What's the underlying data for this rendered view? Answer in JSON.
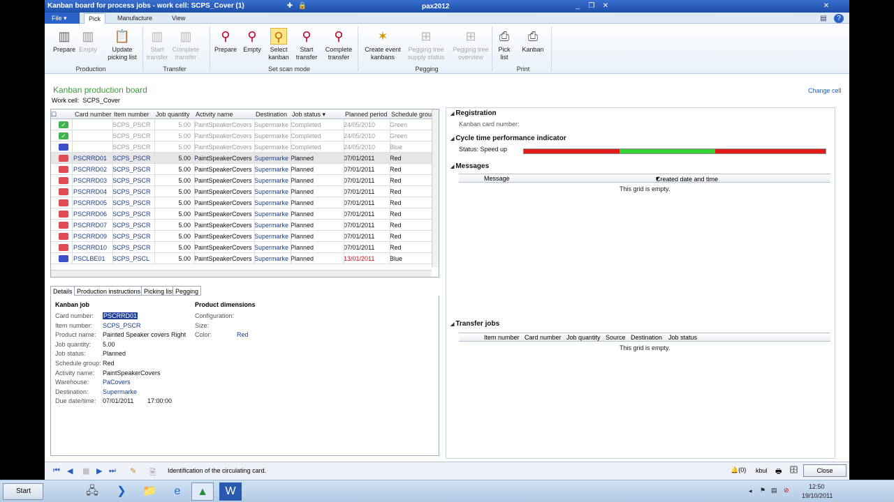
{
  "window": {
    "title": "Kanban board for process jobs - work cell: SCPS_Cover (1)",
    "center": "pax2012"
  },
  "ribbon": {
    "tabs": [
      "File",
      "Pick",
      "Manufacture",
      "View"
    ],
    "buttons": [
      {
        "label": "Prepare",
        "x": 0
      },
      {
        "label": "Empty"
      },
      {
        "label": "Update\npicking list"
      },
      {
        "label": "Start\ntransfer"
      },
      {
        "label": "Complete\ntransfer"
      },
      {
        "label": "Prepare"
      },
      {
        "label": "Empty"
      },
      {
        "label": "Select\nkanban"
      },
      {
        "label": "Start\ntransfer"
      },
      {
        "label": "Complete\ntransfer"
      },
      {
        "label": "Create event\nkanbans"
      },
      {
        "label": "Pegging tree\nsupply status"
      },
      {
        "label": "Pegging tree\noverview"
      },
      {
        "label": "Pick\nlist"
      },
      {
        "label": "Kanban"
      }
    ],
    "groups": [
      "Production",
      "Transfer",
      "Set scan mode",
      "Pegging",
      "Print"
    ]
  },
  "board": {
    "title": "Kanban production board",
    "workcell_label": "Work cell:",
    "workcell": "SCPS_Cover",
    "change_cell": "Change cell"
  },
  "grid": {
    "columns": [
      "Card number",
      "Item number",
      "Job quantity",
      "Activity name",
      "Destination",
      "Job status",
      "Planned period",
      "Schedule grou"
    ],
    "rows": [
      {
        "card": "",
        "item": "SCPS_PSCR",
        "qty": "5.00",
        "activity": "PaintSpeakerCovers",
        "dest": "Supermarke",
        "status": "Completed",
        "period": "24/05/2010",
        "group": "Green"
      },
      {
        "card": "",
        "item": "SCPS_PSCR",
        "qty": "5.00",
        "activity": "PaintSpeakerCovers",
        "dest": "Supermarke",
        "status": "Completed",
        "period": "24/05/2010",
        "group": "Green"
      },
      {
        "card": "",
        "item": "SCPS_PSCR",
        "qty": "5.00",
        "activity": "PaintSpeakerCovers",
        "dest": "Supermarke",
        "status": "Completed",
        "period": "24/05/2010",
        "group": "Blue"
      },
      {
        "card": "PSCRRD01",
        "item": "SCPS_PSCR",
        "qty": "5.00",
        "activity": "PaintSpeakerCovers",
        "dest": "Supermarke",
        "status": "Planned",
        "period": "07/01/2011",
        "group": "Red"
      },
      {
        "card": "PSCRRD02",
        "item": "SCPS_PSCR",
        "qty": "5.00",
        "activity": "PaintSpeakerCovers",
        "dest": "Supermarke",
        "status": "Planned",
        "period": "07/01/2011",
        "group": "Red"
      },
      {
        "card": "PSCRRD03",
        "item": "SCPS_PSCR",
        "qty": "5.00",
        "activity": "PaintSpeakerCovers",
        "dest": "Supermarke",
        "status": "Planned",
        "period": "07/01/2011",
        "group": "Red"
      },
      {
        "card": "PSCRRD04",
        "item": "SCPS_PSCR",
        "qty": "5.00",
        "activity": "PaintSpeakerCovers",
        "dest": "Supermarke",
        "status": "Planned",
        "period": "07/01/2011",
        "group": "Red"
      },
      {
        "card": "PSCRRD05",
        "item": "SCPS_PSCR",
        "qty": "5.00",
        "activity": "PaintSpeakerCovers",
        "dest": "Supermarke",
        "status": "Planned",
        "period": "07/01/2011",
        "group": "Red"
      },
      {
        "card": "PSCRRD06",
        "item": "SCPS_PSCR",
        "qty": "5.00",
        "activity": "PaintSpeakerCovers",
        "dest": "Supermarke",
        "status": "Planned",
        "period": "07/01/2011",
        "group": "Red"
      },
      {
        "card": "PSCRRD07",
        "item": "SCPS_PSCR",
        "qty": "5.00",
        "activity": "PaintSpeakerCovers",
        "dest": "Supermarke",
        "status": "Planned",
        "period": "07/01/2011",
        "group": "Red"
      },
      {
        "card": "PSCRRD09",
        "item": "SCPS_PSCR",
        "qty": "5.00",
        "activity": "PaintSpeakerCovers",
        "dest": "Supermarke",
        "status": "Planned",
        "period": "07/01/2011",
        "group": "Red"
      },
      {
        "card": "PSCRRD10",
        "item": "SCPS_PSCR",
        "qty": "5.00",
        "activity": "PaintSpeakerCovers",
        "dest": "Supermarke",
        "status": "Planned",
        "period": "07/01/2011",
        "group": "Red"
      },
      {
        "card": "PSCLBE01",
        "item": "SCPS_PSCL",
        "qty": "5.00",
        "activity": "PaintSpeakerCovers",
        "dest": "Supermarke",
        "status": "Planned",
        "period": "13/01/2011",
        "group": "Blue"
      }
    ]
  },
  "detail_tabs": [
    "Details",
    "Production instructions",
    "Picking list",
    "Pegging"
  ],
  "details": {
    "kanban_job": "Kanban job",
    "fields": [
      {
        "label": "Card number:",
        "value": "PSCRRD01"
      },
      {
        "label": "Item number:",
        "value": "SCPS_PSCR"
      },
      {
        "label": "Product name:",
        "value": "Painted Speaker covers Right"
      },
      {
        "label": "Job quantity:",
        "value": "5.00"
      },
      {
        "label": "Job status:",
        "value": "Planned"
      },
      {
        "label": "Schedule group:",
        "value": "Red"
      },
      {
        "label": "Activity name:",
        "value": "PaintSpeakerCovers"
      },
      {
        "label": "Warehouse:",
        "value": "PaCovers"
      },
      {
        "label": "Destination:",
        "value": "Supermarke"
      },
      {
        "label": "Due date/time:",
        "value": "07/01/2011"
      }
    ],
    "due_time": "17:00:00",
    "product_dimensions": "Product dimensions",
    "dims": [
      {
        "label": "Configuration:",
        "value": ""
      },
      {
        "label": "Size:",
        "value": ""
      },
      {
        "label": "Color:",
        "value": "Red"
      }
    ]
  },
  "right": {
    "registration": "Registration",
    "kanban_card_label": "Kanban card number:",
    "cycle": "Cycle time performance indicator",
    "status": "Status: Speed up",
    "messages": "Messages",
    "msg_cols": [
      "Message",
      "Created date and time"
    ],
    "empty": "This grid is empty.",
    "transfer": "Transfer jobs",
    "tr_cols": [
      "Item number",
      "Card number",
      "Job quantity",
      "Source",
      "Destination",
      "Job status"
    ]
  },
  "status_bar": {
    "text": "Identification of the circulating card.",
    "alerts": "(0)",
    "user": "kbul",
    "close": "Close"
  },
  "taskbar": {
    "start": "Start",
    "time": "12:50",
    "date": "19/10/2011"
  },
  "colors": {
    "flag_red": "#e24a55",
    "flag_green": "#3fb24a",
    "flag_blue": "#3a4fc8",
    "gauge_red": "#e11b1b",
    "gauge_green": "#35d335"
  }
}
